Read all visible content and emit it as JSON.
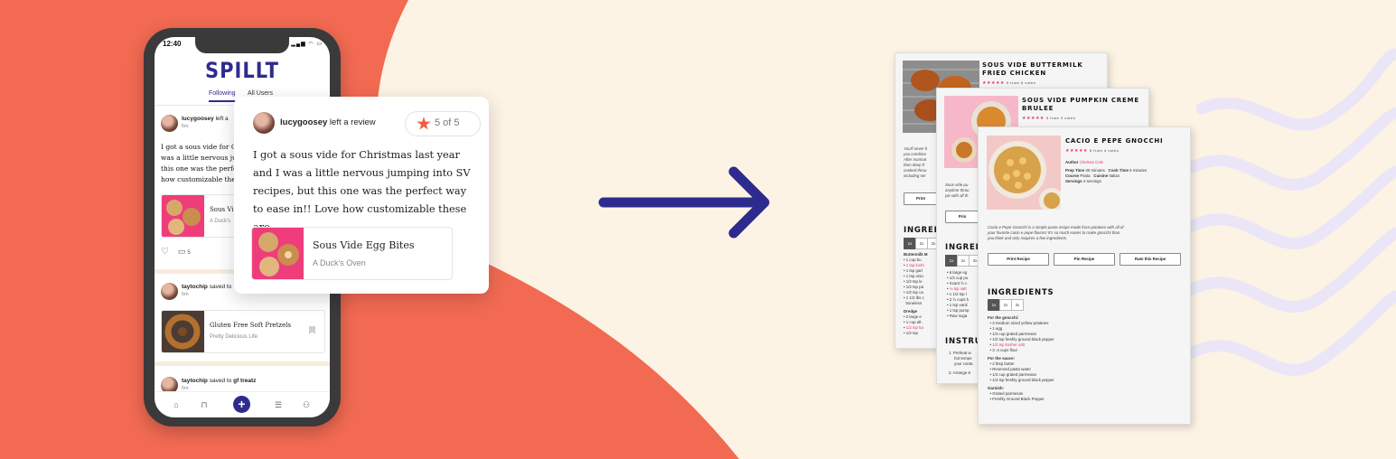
{
  "phone": {
    "status_time": "12:40",
    "status_icons": "▂▄▆ ◠ ▭",
    "logo": "SPILLT",
    "tabs": [
      "Following",
      "All Users"
    ],
    "feed": [
      {
        "user": "lucygoosey",
        "action": "left a",
        "time": "6m",
        "text_lines": [
          "I got a sous vide for Christ",
          "was a little nervous jum",
          "this one was the perfe",
          "how customizable the"
        ],
        "recipe_title": "Sous Vi",
        "recipe_source": "A Duck's",
        "comment_count": "5"
      },
      {
        "user": "taytochip",
        "action": "saved to",
        "time": "6m",
        "recipe_title": "Gluten Free Soft Pretzels",
        "recipe_source": "Pretty Delicious Life"
      },
      {
        "user": "taytochip",
        "action": "saved to",
        "target": "gf treatz",
        "time": "6m"
      }
    ],
    "nav_icons": [
      "home-icon",
      "bookmark-icon",
      "plus-icon",
      "list-icon",
      "profile-icon"
    ]
  },
  "review": {
    "user": "lucygoosey",
    "action": "left a review",
    "rating": "5 of 5",
    "text": "I got a sous vide for Christmas last year and I was a little nervous jumping into SV recipes, but this one was the perfect way to ease in!! Love how customizable these are.",
    "recipe_title": "Sous Vide Egg Bites",
    "recipe_source": "A Duck's Oven"
  },
  "docs": {
    "back": {
      "title_1": "SOUS VIDE BUTTERMILK",
      "title_2": "FRIED CHICKEN",
      "votes": "5 from 6 votes",
      "intro_lines": [
        "You'll never h",
        "you combine",
        "After marinat",
        "then deep fr",
        "cooked throu",
        "including ser"
      ],
      "print_label": "Print",
      "ingredients_heading": "INGRED",
      "multipliers": [
        "1x",
        "2x",
        "3x"
      ],
      "group_1": "Buttermilk M",
      "items_1": [
        "1 cup bu",
        "1 tsp kosh",
        "1 tsp garl",
        "1 tsp onio",
        "1/2 tsp le",
        "1/2 tsp pa",
        "1/2 tsp ca",
        "1 1/2 lbs c",
        "boneless"
      ],
      "group_2": "Dredge",
      "items_2": [
        "2 large e",
        "1 cup all-",
        "1/2 tsp ka",
        "1/2 tsp"
      ]
    },
    "middle": {
      "title_1": "SOUS VIDE PUMPKIN CREME",
      "title_2": "BRULEE",
      "votes": "5 from 3 votes",
      "intro_lines": [
        "Sous vide pu",
        "anytime throu",
        "pie with all th"
      ],
      "print_label": "Prin",
      "ingredients_heading": "INGRED",
      "multipliers": [
        "1x",
        "2x",
        "3x"
      ],
      "items": [
        "6 large eg",
        "1/2 cup pu",
        "Scant ½ c",
        "⅛ tsp salt",
        "1 1/2 tsp l",
        "2 ½ cups h",
        "1 tsp vanil",
        "1 tsp pump",
        "Raw suga"
      ],
      "instructions_heading": "INSTRUC",
      "steps": [
        "1. Preheat w",
        "hot tempe",
        "your conta",
        "2. Arrange 8"
      ]
    },
    "front": {
      "title": "CACIO E PEPE GNOCCHI",
      "votes": "5 from 4 votes",
      "author_label": "Author",
      "author": "Chelsea Cole",
      "prep_label": "Prep Time",
      "prep": "30 minutes",
      "cook_label": "Cook Time",
      "cook": "5 minutes",
      "course_label": "Course",
      "course": "Pasta",
      "cuisine_label": "Cuisine",
      "cuisine": "Italian",
      "servings_label": "Servings",
      "servings": "4 servings",
      "description": [
        "Cacio e Pepe Gnocchi is a simple pasta recipe made from potatoes with all of",
        "your favorite cacio e pepe flavors! It's so much easier to make gnocchi than",
        "you think and only requires a few ingredients."
      ],
      "buttons": [
        "Print Recipe",
        "Pin Recipe",
        "Rate this Recipe"
      ],
      "ingredients_heading": "INGREDIENTS",
      "multipliers": [
        "1x",
        "2x",
        "3x"
      ],
      "group_1": "For the gnocchi:",
      "items_1": [
        "3 medium sized yellow potatoes",
        "1 egg",
        "1/4 cup grated parmesan",
        "1/2 tsp freshly ground black pepper",
        "1/2 tsp kosher salt",
        "3 -4 cups flour"
      ],
      "group_2": "For the sauce:",
      "items_2": [
        "2 tbsp butter",
        "Reserved pasta water",
        "1/4 cup grated parmesan",
        "1/4 tsp freshly ground black pepper"
      ],
      "group_3": "Garnish:",
      "items_3": [
        "Grated parmesan",
        "Freshly Ground Black Pepper"
      ]
    }
  },
  "colors": {
    "coral": "#f26a52",
    "cream": "#fdf3e4",
    "navy": "#2e2b8f",
    "wave": "#ebe6f7",
    "pink": "#e8327a"
  }
}
